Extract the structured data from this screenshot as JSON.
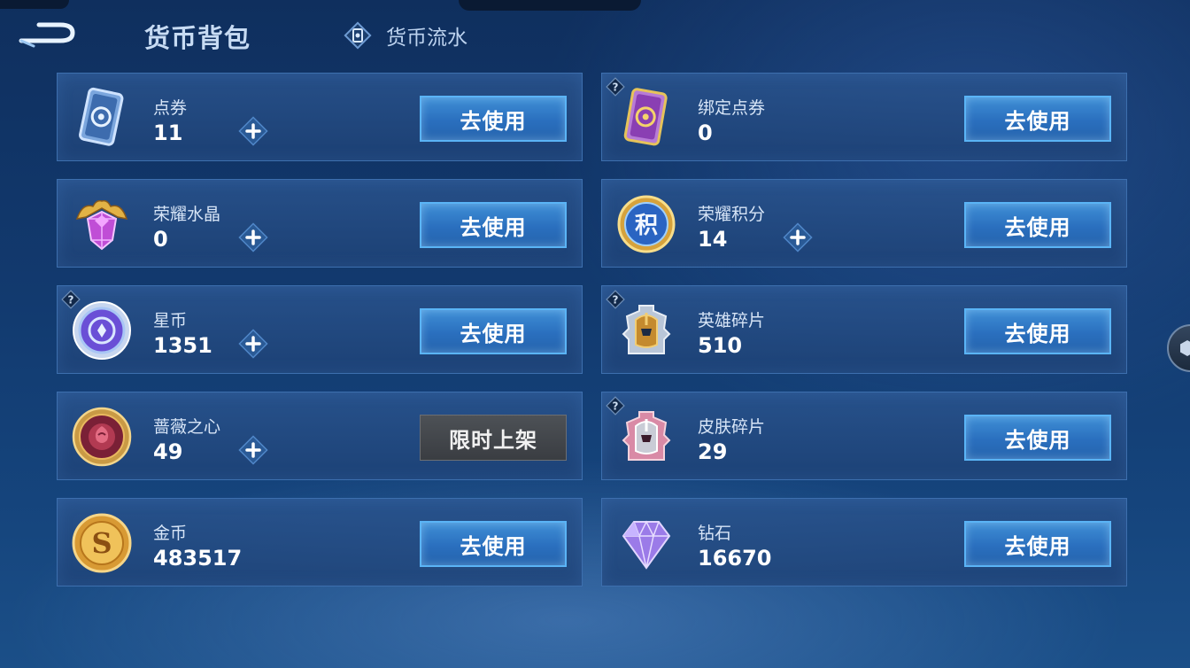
{
  "header": {
    "title": "货币背包",
    "flow_tab_label": "货币流水"
  },
  "buttons": {
    "use_label": "去使用",
    "limited_label": "限时上架"
  },
  "currencies": [
    {
      "name": "点券",
      "value": "11"
    },
    {
      "name": "绑定点券",
      "value": "0"
    },
    {
      "name": "荣耀水晶",
      "value": "0"
    },
    {
      "name": "荣耀积分",
      "value": "14"
    },
    {
      "name": "星币",
      "value": "1351"
    },
    {
      "name": "英雄碎片",
      "value": "510"
    },
    {
      "name": "蔷薇之心",
      "value": "49"
    },
    {
      "name": "皮肤碎片",
      "value": "29"
    },
    {
      "name": "金币",
      "value": "483517"
    },
    {
      "name": "钻石",
      "value": "16670"
    }
  ],
  "icon_names": [
    "ticket-icon",
    "bound-ticket-icon",
    "glory-crystal-icon",
    "glory-points-icon",
    "star-coin-icon",
    "hero-fragment-icon",
    "rose-heart-icon",
    "skin-fragment-icon",
    "gold-coin-icon",
    "diamond-icon"
  ],
  "icon_text": {
    "glory_points_glyph": "积",
    "gold_coin_glyph": "S"
  },
  "colors": {
    "button_blue": "#2a6fbe",
    "button_border": "#5ab4f6",
    "card_border": "#3d6fae",
    "limited_gray": "#3a3d42"
  }
}
